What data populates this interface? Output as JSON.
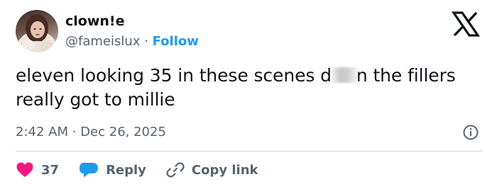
{
  "author": {
    "display_name": "clown!e",
    "handle": "@fameislux",
    "separator": "·",
    "follow_label": "Follow"
  },
  "tweet": {
    "line1_before": "eleven looking 35 in these scenes d",
    "line1_after": "n the fillers",
    "line2": "really got to millie",
    "timestamp": "2:42 AM",
    "date_separator": "·",
    "date": "Dec 26, 2025"
  },
  "actions": {
    "likes_count": "37",
    "reply_label": "Reply",
    "copy_link_label": "Copy link"
  },
  "colors": {
    "accent": "#1d9bf0",
    "like": "#f91880",
    "secondary_text": "#536471",
    "divider": "#cfd9de"
  },
  "icons": [
    "x-logo-icon",
    "info-icon",
    "heart-icon",
    "reply-bubble-icon",
    "link-icon"
  ]
}
